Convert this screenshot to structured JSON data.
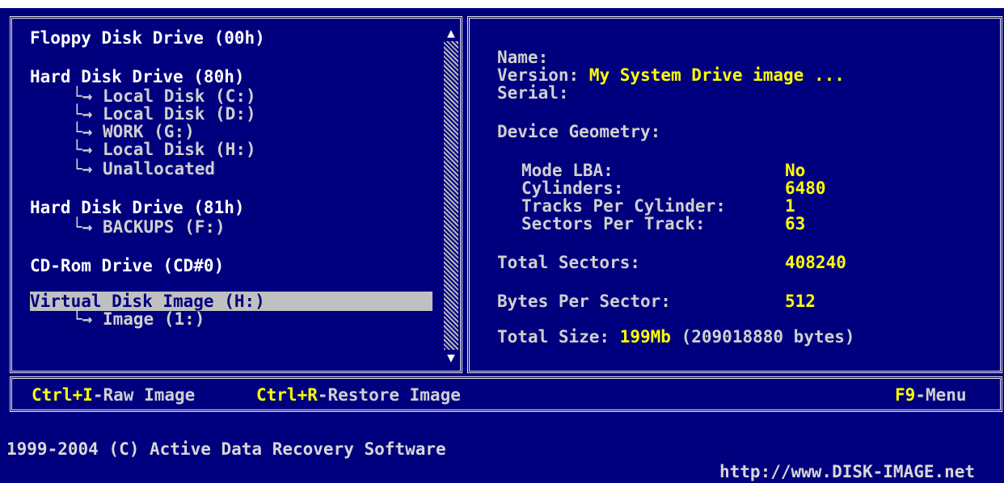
{
  "tree": {
    "floppy": "Floppy Disk Drive (00h)",
    "hdd80": "Hard Disk Drive (80h)",
    "hdd80_children": [
      "Local Disk (C:)",
      "Local Disk (D:)",
      "WORK (G:)",
      "Local Disk (H:)",
      "Unallocated"
    ],
    "hdd81": "Hard Disk Drive (81h)",
    "hdd81_children": [
      "BACKUPS (F:)"
    ],
    "cdrom": "CD-Rom Drive (CD#0)",
    "vdi": "Virtual Disk Image (H:)",
    "vdi_children": [
      "Image (1:)"
    ],
    "arrow_glyph": "└→"
  },
  "details": {
    "name_label": "Name:",
    "version_label": "Version:",
    "version_value": "My System Drive image ...",
    "serial_label": "Serial:",
    "geometry_title": "Device Geometry:",
    "mode_lba_label": "Mode LBA:",
    "mode_lba_value": "No",
    "cylinders_label": "Cylinders:",
    "cylinders_value": "6480",
    "tracks_label": "Tracks Per Cylinder:",
    "tracks_value": "1",
    "sectors_track_label": "Sectors Per Track:",
    "sectors_track_value": "63",
    "total_sectors_label": "Total Sectors:",
    "total_sectors_value": "408240",
    "bytes_sector_label": "Bytes Per Sector:",
    "bytes_sector_value": "512",
    "total_size_label": "Total Size:",
    "total_size_value": "199Mb",
    "total_size_bytes": "(209018880 bytes)"
  },
  "hotkeys": {
    "raw_key": "Ctrl+I",
    "raw_label": "-Raw Image",
    "restore_key": "Ctrl+R",
    "restore_label": "-Restore Image",
    "menu_key": "F9",
    "menu_label": "-Menu"
  },
  "footer": {
    "copyright": "1999-2004 (C) Active Data Recovery Software",
    "url": "http://www.DISK-IMAGE.net"
  },
  "colors": {
    "background": "#00007f",
    "highlight": "#ffff00",
    "text": "#d8d8d8",
    "selection": "#c0c0c0"
  }
}
